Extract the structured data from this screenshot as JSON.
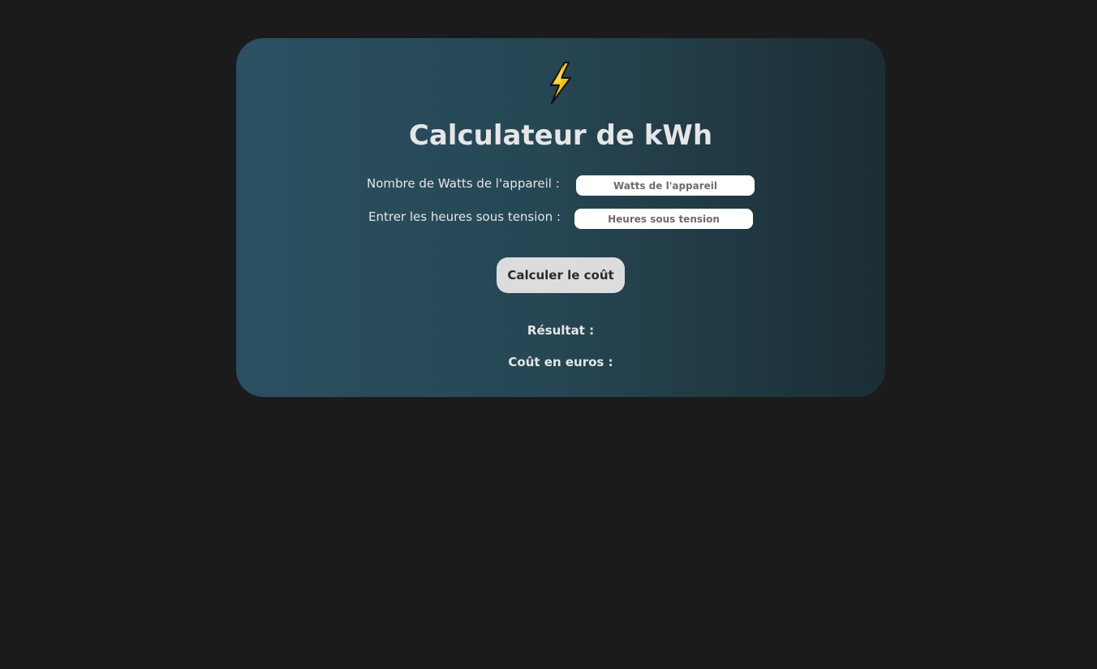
{
  "header": {
    "icon": "lightning-bolt-icon",
    "title": "Calculateur de kWh"
  },
  "form": {
    "watts_label": "Nombre de Watts de l'appareil :",
    "watts_placeholder": "Watts de l'appareil",
    "watts_value": "",
    "hours_label": "Entrer les heures sous tension :",
    "hours_placeholder": "Heures sous tension",
    "hours_value": "",
    "submit_label": "Calculer le coût"
  },
  "results": {
    "result_label": "Résultat :",
    "cost_label": "Coût en euros :"
  },
  "colors": {
    "page_background": "#1b1b1b",
    "card_gradient_start": "#2a5062",
    "card_gradient_end": "#1c2d34",
    "bolt_fill": "#f7c600",
    "text": "#e6e6e6",
    "button_background": "#dcdcdc"
  }
}
